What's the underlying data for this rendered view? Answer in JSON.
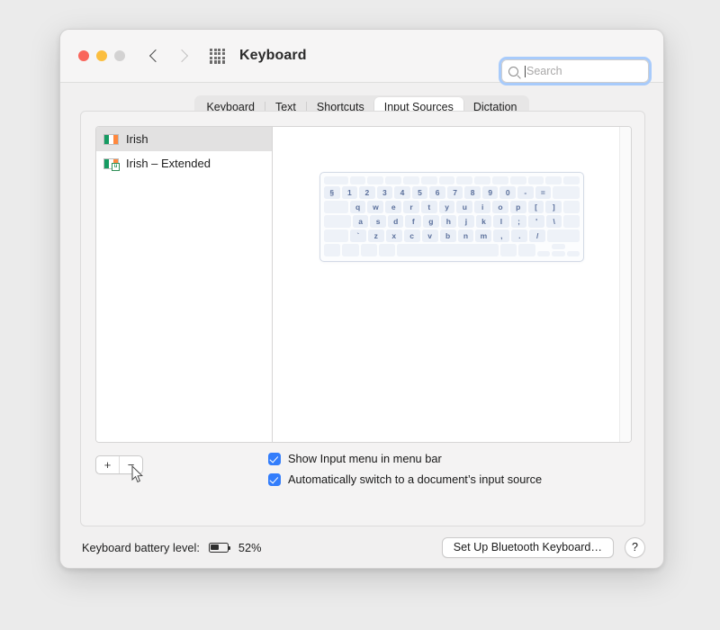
{
  "window": {
    "title": "Keyboard",
    "traffic_lights": [
      "close",
      "minimize",
      "zoom"
    ],
    "nav": {
      "back": "back-chevron",
      "forward": "forward-chevron",
      "grid": "all-preferences-grid"
    }
  },
  "search": {
    "placeholder": "Search",
    "value": "",
    "icon": "search-icon"
  },
  "tabs": [
    {
      "label": "Keyboard",
      "active": false
    },
    {
      "label": "Text",
      "active": false
    },
    {
      "label": "Shortcuts",
      "active": false
    },
    {
      "label": "Input Sources",
      "active": true
    },
    {
      "label": "Dictation",
      "active": false
    }
  ],
  "input_sources": {
    "items": [
      {
        "label": "Irish",
        "selected": true,
        "flag": "irish-flag-icon",
        "badge": ""
      },
      {
        "label": "Irish – Extended",
        "selected": false,
        "flag": "irish-flag-icon",
        "badge": "u"
      }
    ],
    "add_label": "+",
    "remove_label": "−"
  },
  "keyboard_preview": {
    "rows": [
      {
        "name": "function-row",
        "keys": [
          "",
          "",
          "",
          "",
          "",
          "",
          "",
          "",
          "",
          "",
          "",
          "",
          ""
        ]
      },
      {
        "name": "number-row",
        "keys": [
          "§",
          "1",
          "2",
          "3",
          "4",
          "5",
          "6",
          "7",
          "8",
          "9",
          "0",
          "-",
          "=",
          ""
        ]
      },
      {
        "name": "qwerty-row",
        "keys": [
          "",
          "q",
          "w",
          "e",
          "r",
          "t",
          "y",
          "u",
          "i",
          "o",
          "p",
          "[",
          "]",
          ""
        ]
      },
      {
        "name": "home-row",
        "keys": [
          "",
          "a",
          "s",
          "d",
          "f",
          "g",
          "h",
          "j",
          "k",
          "l",
          ";",
          "'",
          "\\",
          ""
        ]
      },
      {
        "name": "bottom-letter-row",
        "keys": [
          "",
          "`",
          "z",
          "x",
          "c",
          "v",
          "b",
          "n",
          "m",
          ",",
          ".",
          "/",
          ""
        ]
      },
      {
        "name": "modifier-row",
        "keys": [
          "",
          "",
          "",
          "",
          "",
          "",
          "",
          ""
        ]
      }
    ]
  },
  "options": [
    {
      "label": "Show Input menu in menu bar",
      "checked": true
    },
    {
      "label": "Automatically switch to a document’s input source",
      "checked": true
    }
  ],
  "footer": {
    "battery_label": "Keyboard battery level:",
    "battery_percent": "52%",
    "battery_fill": 52,
    "setup_button": "Set Up Bluetooth Keyboard…",
    "help_button": "?"
  },
  "colors": {
    "accent": "#337dfb",
    "focus_ring": "#a8cbfb",
    "flag_green": "#169b62",
    "flag_orange": "#ff883e",
    "key_text": "#5a6f9b"
  }
}
